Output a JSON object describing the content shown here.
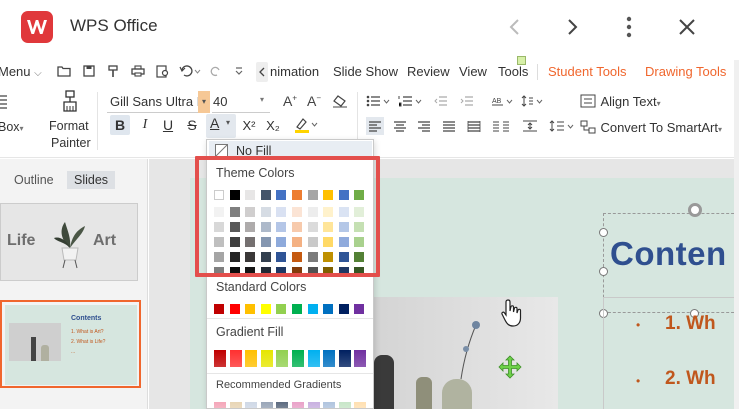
{
  "app": {
    "title": "WPS Office"
  },
  "tabs": {
    "menu": "Menu",
    "animation": "nimation",
    "slideshow": "Slide Show",
    "review": "Review",
    "view": "View",
    "tools": "Tools",
    "student_tools": "Student Tools",
    "drawing_tools": "Drawing Tools"
  },
  "toolbar": {
    "box_label": "Box",
    "format_painter_line1": "Format",
    "format_painter_line2": "Painter",
    "font_name": "Gill Sans Ultra B",
    "font_size": "40",
    "bold": "B",
    "italic": "I",
    "underline": "U",
    "strike": "S",
    "font_color": "A",
    "superscript": "X²",
    "subscript": "X₂",
    "align_text": "Align Text",
    "convert_smartart": "Convert To SmartArt"
  },
  "pane": {
    "outline": "Outline",
    "slides": "Slides"
  },
  "thumbs": {
    "t1_left": "Life",
    "t1_right": "Art",
    "t2_title": "Contents",
    "t2_l1": "1. What is Art?",
    "t2_l2": "2. What is Life?",
    "t2_l3": "..."
  },
  "slide": {
    "title": "Conten",
    "bullet1": "1. Wh",
    "bullet2": "2. Wh"
  },
  "color_menu": {
    "no_fill": "No Fill",
    "theme_colors": "Theme Colors",
    "standard_colors": "Standard Colors",
    "gradient_fill": "Gradient Fill",
    "recommended_gradients": "Recommended Gradients",
    "theme_top": [
      "#ffffff",
      "#000000",
      "#e7e6e6",
      "#44546a",
      "#4472c4",
      "#ed7d31",
      "#a5a5a5",
      "#ffc000",
      "#4472c4",
      "#70ad47"
    ],
    "theme_shades": [
      [
        "#f2f2f2",
        "#7f7f7f",
        "#d0cece",
        "#d6dce4",
        "#d9e1f2",
        "#fbe4d5",
        "#ededed",
        "#fff2cc",
        "#dae3f3",
        "#e2efd9"
      ],
      [
        "#d8d8d8",
        "#595959",
        "#aeabab",
        "#adb9ca",
        "#b4c6e7",
        "#f7caac",
        "#dbdbdb",
        "#ffe599",
        "#b4c7e7",
        "#c5e0b3"
      ],
      [
        "#bfbfbf",
        "#3f3f3f",
        "#757070",
        "#8496b0",
        "#8eaadb",
        "#f4b183",
        "#c9c9c9",
        "#ffd966",
        "#8faadc",
        "#a9d18e"
      ],
      [
        "#a5a5a5",
        "#262626",
        "#3a3838",
        "#323f4f",
        "#2f5496",
        "#c55a11",
        "#7b7b7b",
        "#bf9000",
        "#2f5597",
        "#538135"
      ],
      [
        "#7f7f7f",
        "#0c0c0c",
        "#171616",
        "#222a35",
        "#1f3864",
        "#833c0b",
        "#525252",
        "#7f6000",
        "#1f3864",
        "#375623"
      ]
    ],
    "standard": [
      "#c00000",
      "#ff0000",
      "#ffc000",
      "#ffff00",
      "#92d050",
      "#00b050",
      "#00b0f0",
      "#0070c0",
      "#002060",
      "#7030a0"
    ],
    "gradients": [
      "#c00000",
      "#ff3030",
      "#ffc000",
      "#e6e600",
      "#92d050",
      "#00b050",
      "#00b0f0",
      "#0070c0",
      "#002060",
      "#7030a0"
    ],
    "recommended": [
      "#f4a7b9",
      "#e8d5b5",
      "#cfd8e6",
      "#9aa6b8",
      "#5d6b80",
      "#e9a3c9",
      "#c9b1e0",
      "#b0c4de",
      "#c8e6c9",
      "#ffe0b2"
    ]
  },
  "colors": {
    "accent": "#f0662d",
    "highlight": "#e34f4c",
    "slide_title": "#2f4f8f",
    "slide_bullet": "#c0571d"
  }
}
